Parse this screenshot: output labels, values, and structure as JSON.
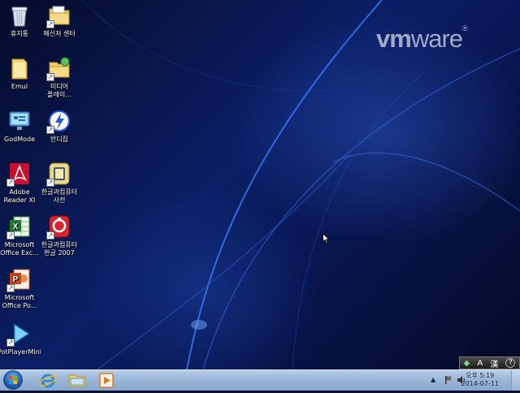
{
  "wallpaper": {
    "logo_vm": "vm",
    "logo_ware": "ware",
    "logo_reg": "®"
  },
  "desktop_icons": [
    {
      "label": "휴지통",
      "icon": "recycle-bin-icon"
    },
    {
      "label": "메신저 센터",
      "icon": "folder-icon"
    },
    {
      "label": "Emul",
      "icon": "folder-icon"
    },
    {
      "label": "미디어\n플레이...",
      "icon": "folder-shortcut-icon"
    },
    {
      "label": "GodMode",
      "icon": "control-panel-icon"
    },
    {
      "label": "반디집",
      "icon": "bandizip-icon"
    },
    {
      "label": "Adobe\nReader XI",
      "icon": "adobe-reader-icon"
    },
    {
      "label": "한글과컴퓨터\n사전",
      "icon": "hancom-dictionary-icon"
    },
    {
      "label": "Microsoft\nOffice Exc...",
      "icon": "excel-icon"
    },
    {
      "label": "한글과컴퓨터\n한글 2007",
      "icon": "hangul-icon"
    },
    {
      "label": "Microsoft\nOffice Po...",
      "icon": "powerpoint-icon"
    },
    {
      "label": "PotPlayerMini",
      "icon": "potplayer-icon"
    }
  ],
  "language_bar": {
    "mode": "A",
    "hanja": "漢",
    "help": "?"
  },
  "taskbar": {
    "pinned": [
      "internet-explorer-icon",
      "explorer-folder-icon",
      "media-player-icon"
    ],
    "clock_time": "오후 5:19",
    "clock_date": "2014-07-11"
  }
}
